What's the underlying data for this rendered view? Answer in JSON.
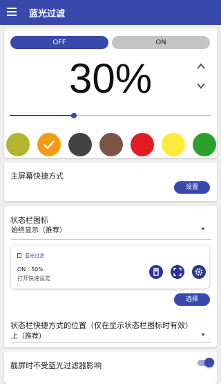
{
  "app_bar": {
    "title": "蓝光过滤",
    "menu_icon": "menu-icon"
  },
  "filter": {
    "off_label": "OFF",
    "on_label": "ON",
    "state": "OFF",
    "percent_text": "30%",
    "slider_level": 0.32
  },
  "colors": [
    {
      "name": "olive",
      "hex": "#b2b32e",
      "selected": false
    },
    {
      "name": "orange",
      "hex": "#f39c12",
      "selected": true
    },
    {
      "name": "dark-gray",
      "hex": "#424242",
      "selected": false
    },
    {
      "name": "brown",
      "hex": "#795548",
      "selected": false
    },
    {
      "name": "red",
      "hex": "#e31b23",
      "selected": false
    },
    {
      "name": "yellow",
      "hex": "#ffeb3b",
      "selected": false
    },
    {
      "name": "green",
      "hex": "#2ca02c",
      "selected": false
    }
  ],
  "home_shortcut": {
    "title": "主屏幕快捷方式",
    "button": "设置"
  },
  "status_icon": {
    "title": "状态栏图标",
    "selected": "始终显示（推荐）",
    "notification": {
      "app_name": "蓝光过滤",
      "line1": "ON : 50%",
      "line2": "打开快速设定"
    },
    "button": "选择"
  },
  "shortcut_position": {
    "title": "状态栏快捷方式的位置（仅在显示状态栏图标时有效）",
    "selected": "上（推荐）"
  },
  "screenshot_setting": {
    "title": "截屏时不受蓝光过滤器影响",
    "enabled": true
  },
  "theme": {
    "accent": "#3949ab",
    "accent_dark": "#283593"
  }
}
